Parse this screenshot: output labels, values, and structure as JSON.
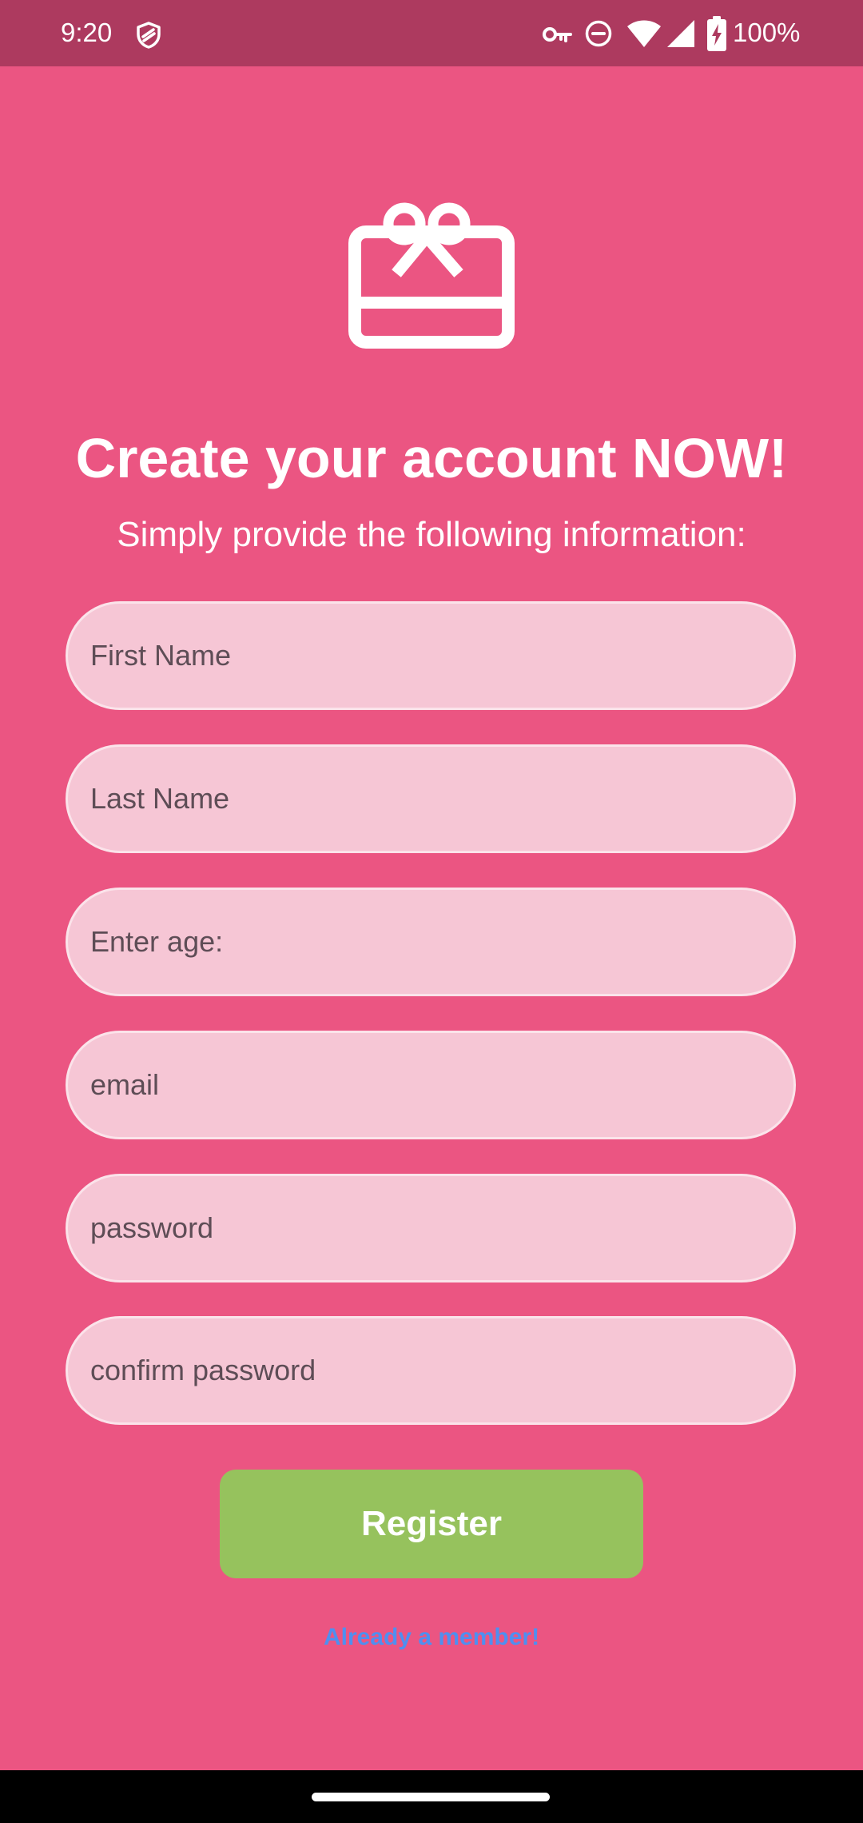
{
  "status_bar": {
    "time": "9:20",
    "battery_text": "100%",
    "icons": [
      "shield-icon",
      "vpn-key-icon",
      "do-not-disturb-icon",
      "wifi-icon",
      "cellular-signal-icon",
      "battery-charging-icon"
    ]
  },
  "header": {
    "icon": "gift-card-icon",
    "title": "Create your account NOW!",
    "subtitle": "Simply provide the following information:"
  },
  "form": {
    "first_name_placeholder": "First Name",
    "last_name_placeholder": "Last Name",
    "age_placeholder": "Enter age:",
    "email_placeholder": "email",
    "password_placeholder": "password",
    "confirm_password_placeholder": "confirm password",
    "register_label": "Register",
    "login_link_label": "Already a member!"
  },
  "colors": {
    "background": "#eb5582",
    "status_bar": "#ad3a5f",
    "field_fill": "#f6c6d5",
    "button": "#96c25d",
    "link": "#4f8ff0"
  }
}
